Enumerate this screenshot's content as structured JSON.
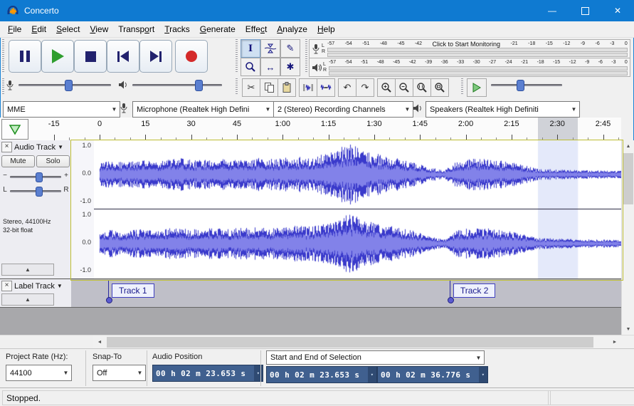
{
  "window": {
    "title": "Concerto"
  },
  "icons": {
    "minimize": "—",
    "close": "✕",
    "dropdown": "▼",
    "dropdown_small": "▾",
    "collapse": "▲",
    "close_track": "×",
    "selection_tool": "I",
    "draw_tool": "✎",
    "timeshift_tool": "↔",
    "multi_tool": "✱",
    "cut": "✂",
    "undo": "↶",
    "redo": "↷",
    "scroll_up": "▲",
    "scroll_down": "▼",
    "scroll_left": "◄",
    "scroll_right": "►"
  },
  "menu": {
    "items": [
      {
        "label": "File",
        "accel": 0
      },
      {
        "label": "Edit",
        "accel": 0
      },
      {
        "label": "Select",
        "accel": 0
      },
      {
        "label": "View",
        "accel": 0
      },
      {
        "label": "Transport",
        "accel": 6
      },
      {
        "label": "Tracks",
        "accel": 0
      },
      {
        "label": "Generate",
        "accel": 0
      },
      {
        "label": "Effect",
        "accel": 4
      },
      {
        "label": "Analyze",
        "accel": 0
      },
      {
        "label": "Help",
        "accel": 0
      }
    ]
  },
  "meters": {
    "channel_labels": [
      "L",
      "R"
    ],
    "record": {
      "left_scale": [
        "-57",
        "-54",
        "-51",
        "-48",
        "-45",
        "-42"
      ],
      "hint": "Click to Start Monitoring",
      "right_scale": [
        "-21",
        "-18",
        "-15",
        "-12",
        "-9",
        "-6",
        "-3",
        "0"
      ]
    },
    "playback": {
      "scale": [
        "-57",
        "-54",
        "-51",
        "-48",
        "-45",
        "-42",
        "-39",
        "-36",
        "-33",
        "-30",
        "-27",
        "-24",
        "-21",
        "-18",
        "-15",
        "-12",
        "-9",
        "-6",
        "-3",
        "0"
      ]
    }
  },
  "device": {
    "host": "MME",
    "input": "Microphone (Realtek High Defini",
    "channels": "2 (Stereo) Recording Channels",
    "output": "Speakers (Realtek High Definiti"
  },
  "timeline": {
    "ticks": [
      {
        "sec": -15,
        "label": "-15"
      },
      {
        "sec": 0,
        "label": "0"
      },
      {
        "sec": 15,
        "label": "15"
      },
      {
        "sec": 30,
        "label": "30"
      },
      {
        "sec": 45,
        "label": "45"
      },
      {
        "sec": 60,
        "label": "1:00"
      },
      {
        "sec": 75,
        "label": "1:15"
      },
      {
        "sec": 90,
        "label": "1:30"
      },
      {
        "sec": 105,
        "label": "1:45"
      },
      {
        "sec": 120,
        "label": "2:00"
      },
      {
        "sec": 135,
        "label": "2:15"
      },
      {
        "sec": 150,
        "label": "2:30"
      },
      {
        "sec": 165,
        "label": "2:45"
      }
    ],
    "selection": {
      "start_sec": 143.653,
      "end_sec": 156.776
    }
  },
  "track": {
    "close": "×",
    "name": "Audio Track",
    "mute": "Mute",
    "solo": "Solo",
    "gain_min": "−",
    "gain_max": "+",
    "pan_left": "L",
    "pan_right": "R",
    "info_line1": "Stereo, 44100Hz",
    "info_line2": "32-bit float",
    "scale": {
      "top": "1.0",
      "mid": "0.0",
      "bottom": "-1.0"
    }
  },
  "label_track": {
    "close": "×",
    "name": "Label Track",
    "labels": [
      {
        "text": "Track 1",
        "sec": 2.8
      },
      {
        "text": "Track 2",
        "sec": 114.7
      }
    ]
  },
  "waveform": {
    "background": "#ffffff",
    "selection_background": "#e4e9fa",
    "peak_color": "#3a3acb",
    "rms_color": "#8282e9",
    "envelope": [
      [
        0.0,
        0.35
      ],
      [
        0.02,
        0.42
      ],
      [
        0.05,
        0.38
      ],
      [
        0.08,
        0.45
      ],
      [
        0.11,
        0.4
      ],
      [
        0.145,
        0.52
      ],
      [
        0.18,
        0.44
      ],
      [
        0.21,
        0.5
      ],
      [
        0.25,
        0.46
      ],
      [
        0.29,
        0.52
      ],
      [
        0.33,
        0.48
      ],
      [
        0.37,
        0.55
      ],
      [
        0.4,
        0.52
      ],
      [
        0.43,
        0.65
      ],
      [
        0.46,
        0.88
      ],
      [
        0.485,
        0.92
      ],
      [
        0.51,
        0.72
      ],
      [
        0.54,
        0.6
      ],
      [
        0.57,
        0.5
      ],
      [
        0.6,
        0.4
      ],
      [
        0.635,
        0.22
      ],
      [
        0.66,
        0.12
      ],
      [
        0.685,
        0.42
      ],
      [
        0.72,
        0.5
      ],
      [
        0.75,
        0.46
      ],
      [
        0.78,
        0.4
      ],
      [
        0.81,
        0.3
      ],
      [
        0.84,
        0.17
      ],
      [
        0.87,
        0.16
      ],
      [
        0.9,
        0.14
      ],
      [
        0.94,
        0.13
      ],
      [
        1.0,
        0.11
      ]
    ]
  },
  "selection_bar": {
    "rate_label": "Project Rate (Hz):",
    "rate_value": "44100",
    "snap_label": "Snap-To",
    "snap_value": "Off",
    "position_label": "Audio Position",
    "position_value": "00 h 02 m 23.653 s",
    "mode_label": "Start and End of Selection",
    "start_value": "00 h 02 m 23.653 s",
    "end_value": "00 h 02 m 36.776 s"
  },
  "status": {
    "text": "Stopped."
  },
  "colors": {
    "titlebar": "#0f7ad1",
    "play_green": "#2f9e2f",
    "record_red": "#d42a2a",
    "waveform_blue": "#3a3acb"
  }
}
